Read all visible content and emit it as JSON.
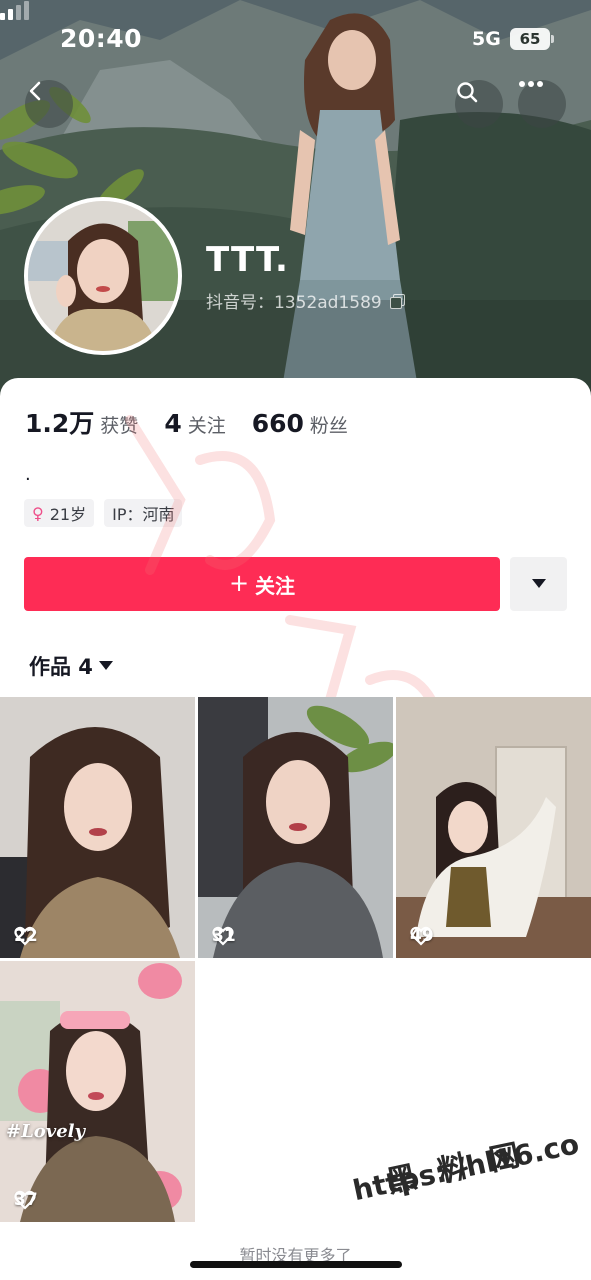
{
  "status_bar": {
    "time": "20:40",
    "network": "5G",
    "battery": "65"
  },
  "header": {
    "back_icon": "chevron-left-icon",
    "search_icon": "search-icon",
    "more_icon": "more-dots-icon"
  },
  "profile": {
    "nickname": "TTT.",
    "douyin_id": "抖音号：1352ad1589",
    "stats": [
      {
        "value": "1.2万",
        "label": "获赞"
      },
      {
        "value": "4",
        "label": "关注"
      },
      {
        "value": "660",
        "label": "粉丝"
      }
    ],
    "bio": ".",
    "tags": {
      "age": "21岁",
      "ip": "IP：河南"
    },
    "follow_label": "关注",
    "follow_plus": "+",
    "accent_color": "#fe2c55"
  },
  "works": {
    "tab_label": "作品 4",
    "items": [
      {
        "likes": "22"
      },
      {
        "likes": "31"
      },
      {
        "likes": "49"
      },
      {
        "likes": "37",
        "overlay_text": "#Lovely"
      }
    ],
    "end_text": "暂时没有更多了"
  },
  "watermark": {
    "site_name": "黑 料 网",
    "url": "https://hl16.co"
  }
}
